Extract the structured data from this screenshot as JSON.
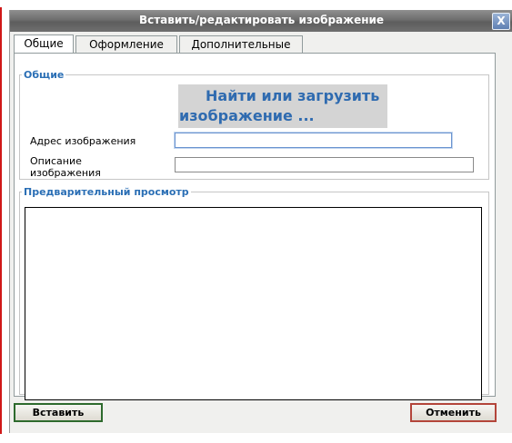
{
  "dialog": {
    "title": "Вставить/редактировать изображение",
    "close_label": "X"
  },
  "tabs": [
    {
      "label": "Общие",
      "active": true
    },
    {
      "label": "Оформление",
      "active": false
    },
    {
      "label": "Дополнительные",
      "active": false
    }
  ],
  "general": {
    "legend": "Общие",
    "browse_line1": "Найти или загрузить",
    "browse_line2": "изображение ...",
    "image_url_label": "Адрес изображения",
    "image_url_value": "",
    "description_label_1": "Описание",
    "description_label_2": "изображения",
    "description_value": ""
  },
  "preview": {
    "legend": "Предварительный просмотр"
  },
  "buttons": {
    "insert": "Вставить",
    "cancel": "Отменить"
  },
  "colors": {
    "accent_text": "#2b6fb5",
    "insert_border": "#2d6a2d",
    "cancel_border": "#b3453a"
  }
}
